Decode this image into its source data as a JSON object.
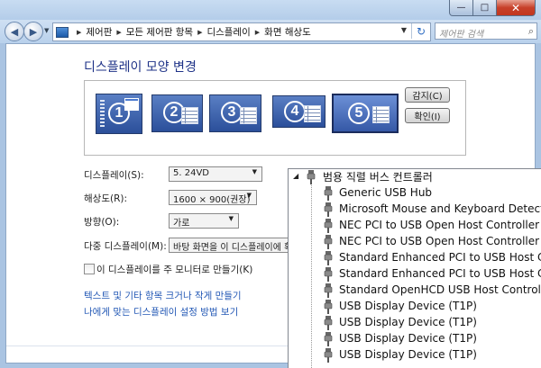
{
  "window": {
    "minimize_glyph": "—",
    "maximize_glyph": "□",
    "close_glyph": "✕"
  },
  "navbar": {
    "breadcrumbs": [
      "제어판",
      "모든 제어판 항목",
      "디스플레이",
      "화면 해상도"
    ],
    "search_placeholder": "제어판 검색",
    "back_icon": "back-arrow-icon",
    "forward_icon": "forward-arrow-icon"
  },
  "main": {
    "title": "디스플레이 모양 변경",
    "monitors": [
      "1",
      "2",
      "3",
      "4",
      "5"
    ],
    "detect_button": "감지(C)",
    "identify_button": "확인(I)",
    "display_label": "디스플레이(S):",
    "display_value": "5. 24VD",
    "resolution_label": "해상도(R):",
    "resolution_value": "1600 × 900(권장)",
    "orientation_label": "방향(O):",
    "orientation_value": "가로",
    "multi_label": "다중 디스플레이(M):",
    "multi_value": "바탕 화면을 이 디스플레이에 확장",
    "primary_checkbox_label": "이 디스플레이를 주 모니터로 만들기(K)",
    "link_text_size": "텍스트 및 기타 항목 크거나 작게 만들기",
    "link_help": "나에게 맞는 디스플레이 설정 방법 보기"
  },
  "device_manager": {
    "category": "범용 직렬 버스 컨트롤러",
    "devices": [
      "Generic USB Hub",
      "Microsoft Mouse and Keyboard Detection",
      "NEC PCI to USB Open Host Controller",
      "NEC PCI to USB Open Host Controller",
      "Standard Enhanced PCI to USB Host Controller",
      "Standard Enhanced PCI to USB Host Controller",
      "Standard OpenHCD USB Host Controller",
      "USB Display Device (T1P)",
      "USB Display Device (T1P)",
      "USB Display Device (T1P)",
      "USB Display Device (T1P)"
    ]
  },
  "colors": {
    "title_blue": "#1e3287",
    "link_blue": "#2358b5",
    "monitor_blue": "#3558a6"
  }
}
